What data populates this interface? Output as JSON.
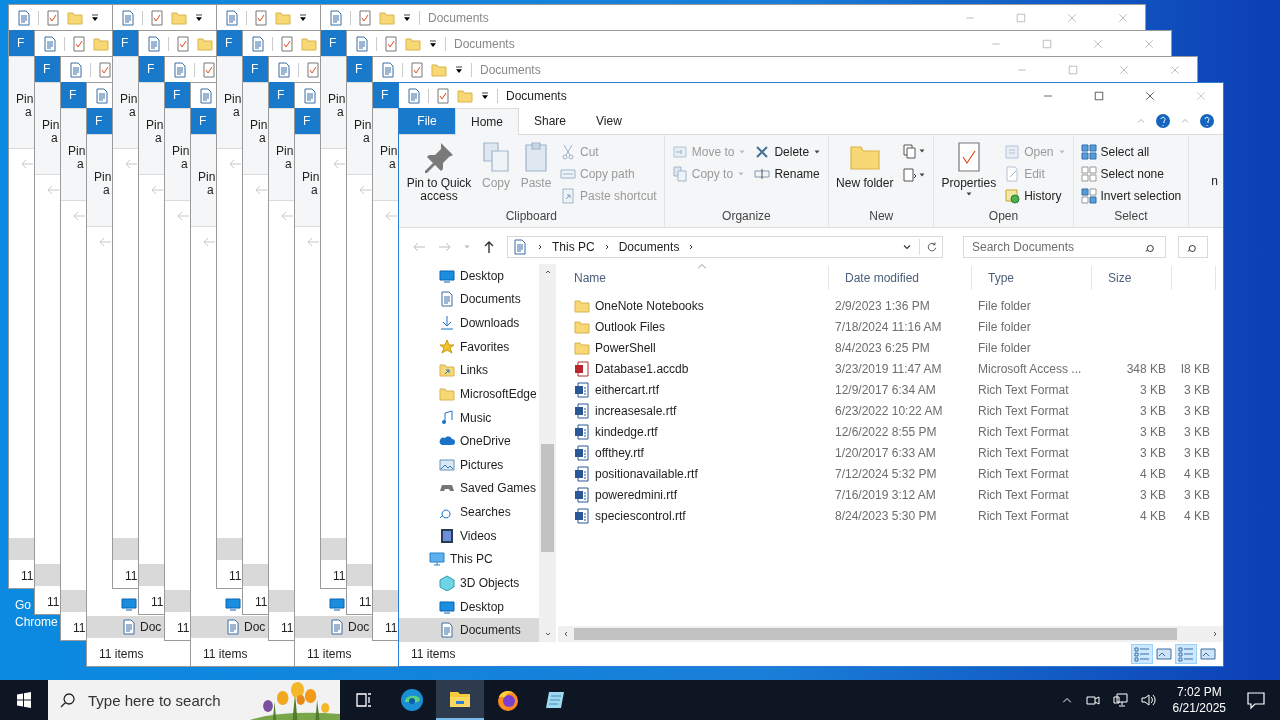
{
  "desktop": {
    "shortcut_label": [
      "Go",
      "Chrome"
    ]
  },
  "background_windows": [
    {
      "tab": "F",
      "pin": "Pin",
      "pin_2": "a",
      "status": "11"
    },
    {
      "tab": "F",
      "pin": "Pin",
      "pin_2": "a",
      "status": "11"
    },
    {
      "tab": "F",
      "pin": "Pin",
      "pin_2": "a",
      "status": "11"
    },
    {
      "tab": "F",
      "pin": "Pin",
      "pin_2": "a",
      "status": "11 items",
      "nav_label": "Doc"
    },
    {
      "tab": "F",
      "pin": "Pin",
      "pin_2": "a",
      "status": "11"
    },
    {
      "tab": "F",
      "pin": "Pin",
      "pin_2": "a",
      "status": "11"
    },
    {
      "tab": "F",
      "pin": "Pin",
      "pin_2": "a",
      "status": "11"
    },
    {
      "tab": "F",
      "pin": "Pin",
      "pin_2": "a",
      "status": "11 items",
      "nav_label": "Doc"
    },
    {
      "tab": "F",
      "pin": "Pin",
      "pin_2": "a",
      "status": "11"
    },
    {
      "tab": "F",
      "pin": "Pin",
      "pin_2": "a",
      "status": "11"
    },
    {
      "tab": "F",
      "pin": "Pin",
      "pin_2": "a",
      "status": "11"
    },
    {
      "tab": "F",
      "pin": "Pin",
      "pin_2": "a",
      "status": "11 items",
      "nav_label": "Doc"
    },
    {
      "tab": "F",
      "pin": "Pin",
      "pin_2": "a",
      "status": "11",
      "title": "Documents"
    },
    {
      "tab": "F",
      "pin": "Pin",
      "pin_2": "a",
      "status": "11",
      "title": "Documents"
    },
    {
      "tab": "F",
      "pin": "Pin",
      "pin_2": "a",
      "status": "11",
      "title": "Documents"
    }
  ],
  "window": {
    "title": "Documents",
    "file_tab": "File",
    "tabs": [
      {
        "label": "Home",
        "selected": true
      },
      {
        "label": "Share",
        "selected": false
      },
      {
        "label": "View",
        "selected": false
      }
    ],
    "ribbon": [
      {
        "label": "Clipboard",
        "columns": [
          {
            "kind": "large",
            "items": [
              {
                "label": "Pin to Quick access",
                "disabled": false,
                "dropdown": false
              }
            ]
          },
          {
            "kind": "large",
            "items": [
              {
                "label": "Copy",
                "disabled": true,
                "dropdown": false
              }
            ]
          },
          {
            "kind": "large",
            "items": [
              {
                "label": "Paste",
                "disabled": true,
                "dropdown": false
              }
            ]
          },
          {
            "kind": "small",
            "items": [
              {
                "label": "Cut",
                "disabled": true,
                "dropdown": false
              },
              {
                "label": "Copy path",
                "disabled": true,
                "dropdown": false
              },
              {
                "label": "Paste shortcut",
                "disabled": true,
                "dropdown": false
              }
            ]
          }
        ]
      },
      {
        "label": "Organize",
        "columns": [
          {
            "kind": "small",
            "items": [
              {
                "label": "Move to",
                "disabled": true,
                "dropdown": true
              },
              {
                "label": "Copy to",
                "disabled": true,
                "dropdown": true
              }
            ]
          },
          {
            "kind": "small",
            "items": [
              {
                "label": "Delete",
                "disabled": false,
                "dropdown": true
              },
              {
                "label": "Rename",
                "disabled": false,
                "dropdown": false
              }
            ]
          }
        ]
      },
      {
        "label": "New",
        "columns": [
          {
            "kind": "large",
            "items": [
              {
                "label": "New folder",
                "disabled": false,
                "dropdown": false
              }
            ]
          },
          {
            "kind": "icons",
            "items": [
              {
                "disabled": false,
                "dropdown": true
              },
              {
                "disabled": false,
                "dropdown": true
              }
            ]
          }
        ]
      },
      {
        "label": "Open",
        "columns": [
          {
            "kind": "large",
            "items": [
              {
                "label": "Properties",
                "disabled": false,
                "dropdown": true
              }
            ]
          },
          {
            "kind": "small",
            "items": [
              {
                "label": "Open",
                "disabled": true,
                "dropdown": true
              },
              {
                "label": "Edit",
                "disabled": true,
                "dropdown": false
              },
              {
                "label": "History",
                "disabled": false,
                "dropdown": false
              }
            ]
          }
        ]
      },
      {
        "label": "Select",
        "columns": [
          {
            "kind": "small",
            "items": [
              {
                "label": "Select all",
                "disabled": false,
                "dropdown": false
              },
              {
                "label": "Select none",
                "disabled": false,
                "dropdown": false
              },
              {
                "label": "Invert selection",
                "disabled": false,
                "dropdown": false
              }
            ]
          }
        ]
      }
    ],
    "ribbon_overflow": "n",
    "address": {
      "path": [
        "This PC",
        "Documents"
      ]
    },
    "search": {
      "placeholder": "Search Documents"
    },
    "nav": [
      {
        "label": "Desktop",
        "selected": false
      },
      {
        "label": "Documents",
        "selected": false
      },
      {
        "label": "Downloads",
        "selected": false
      },
      {
        "label": "Favorites",
        "selected": false
      },
      {
        "label": "Links",
        "selected": false
      },
      {
        "label": "MicrosoftEdge",
        "selected": false
      },
      {
        "label": "Music",
        "selected": false
      },
      {
        "label": "OneDrive",
        "selected": false
      },
      {
        "label": "Pictures",
        "selected": false
      },
      {
        "label": "Saved Games",
        "selected": false
      },
      {
        "label": "Searches",
        "selected": false
      },
      {
        "label": "Videos",
        "selected": false
      },
      {
        "label": "This PC",
        "selected": false,
        "children": [
          {
            "label": "3D Objects",
            "selected": false
          },
          {
            "label": "Desktop",
            "selected": false
          },
          {
            "label": "Documents",
            "selected": true
          }
        ]
      }
    ],
    "columns": [
      "Name",
      "Date modified",
      "Type",
      "Size"
    ],
    "files": [
      {
        "kind": "folder",
        "name": "OneNote Notebooks",
        "date": "2/9/2023 1:36 PM",
        "type": "File folder"
      },
      {
        "kind": "folder",
        "name": "Outlook Files",
        "date": "7/18/2024 11:16 AM",
        "type": "File folder"
      },
      {
        "kind": "folder",
        "name": "PowerShell",
        "date": "8/4/2023 6:25 PM",
        "type": "File folder"
      },
      {
        "kind": "access",
        "name": "Database1.accdb",
        "date": "3/23/2019 11:47 AM",
        "type": "Microsoft Access ...",
        "size": "348 KB",
        "column_5": "I8 KB"
      },
      {
        "kind": "rtf",
        "name": "eithercart.rtf",
        "date": "12/9/2017 6:34 AM",
        "type": "Rich Text Format",
        "size": "3 KB",
        "column_5": "3 KB"
      },
      {
        "kind": "rtf",
        "name": "increasesale.rtf",
        "date": "6/23/2022 10:22 AM",
        "type": "Rich Text Format",
        "size": "3 KB",
        "column_5": "3 KB"
      },
      {
        "kind": "rtf",
        "name": "kindedge.rtf",
        "date": "12/6/2022 8:55 PM",
        "type": "Rich Text Format",
        "size": "3 KB",
        "column_5": "3 KB"
      },
      {
        "kind": "rtf",
        "name": "offthey.rtf",
        "date": "1/20/2017 6:33 AM",
        "type": "Rich Text Format",
        "size": "3 KB",
        "column_5": "3 KB"
      },
      {
        "kind": "rtf",
        "name": "positionavailable.rtf",
        "date": "7/12/2024 5:32 PM",
        "type": "Rich Text Format",
        "size": "4 KB",
        "column_5": "4 KB"
      },
      {
        "kind": "rtf",
        "name": "poweredmini.rtf",
        "date": "7/16/2019 3:12 AM",
        "type": "Rich Text Format",
        "size": "3 KB",
        "column_5": "3 KB"
      },
      {
        "kind": "rtf",
        "name": "speciescontrol.rtf",
        "date": "8/24/2023 5:30 PM",
        "type": "Rich Text Format",
        "size": "4 KB",
        "column_5": "4 KB"
      }
    ],
    "status": "11 items"
  },
  "taskbar": {
    "search_placeholder": "Type here to search",
    "apps": [
      {
        "kind": "taskview",
        "selected": false
      },
      {
        "kind": "edge",
        "selected": false
      },
      {
        "kind": "explorer",
        "selected": true
      },
      {
        "kind": "firefox",
        "selected": false
      },
      {
        "kind": "app",
        "selected": false
      }
    ],
    "time": "7:02 PM",
    "date": "6/21/2025"
  }
}
